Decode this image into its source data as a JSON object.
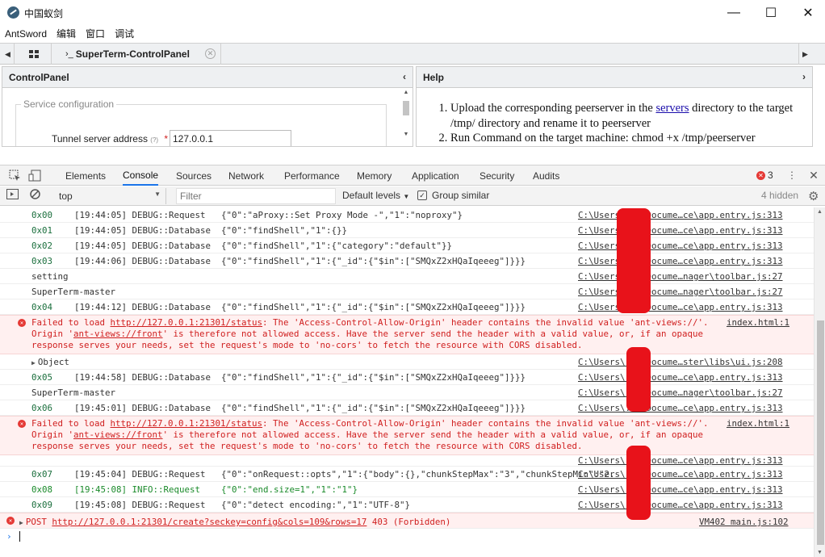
{
  "window": {
    "title": "中国蚁剑",
    "minimize": "—",
    "maximize": "☐",
    "close": "✕"
  },
  "menu": [
    "AntSword",
    "编辑",
    "窗口",
    "调试"
  ],
  "tabs": {
    "active_label": "SuperTerm-ControlPanel",
    "prompt_glyph": "›_"
  },
  "control_panel": {
    "title": "ControlPanel",
    "fieldset_legend": "Service configuration",
    "tunnel_label": "Tunnel server address",
    "tunnel_hint": "(?)",
    "required_mark": "*",
    "tunnel_value": "127.0.0.1"
  },
  "help": {
    "title": "Help",
    "step1_pre": "Upload the corresponding peerserver in the ",
    "step1_link": "servers",
    "step1_post": " directory to the target /tmp/ directory and rename it to peerserver",
    "step2": "Run Command on the target machine: chmod +x /tmp/peerserver"
  },
  "devtools": {
    "tabs": [
      "Elements",
      "Console",
      "Sources",
      "Network",
      "Performance",
      "Memory",
      "Application",
      "Security",
      "Audits"
    ],
    "active_tab": "Console",
    "error_count": "3",
    "context": "top",
    "filter_placeholder": "Filter",
    "levels": "Default levels",
    "group_similar": "Group similar",
    "hidden": "4 hidden"
  },
  "console": {
    "rows": [
      {
        "id": "0x00",
        "msg": "[19:44:05] DEBUG::Request   {\"0\":\"aProxy::Set Proxy Mode -\",\"1\":\"noproxy\"}",
        "src": "C:\\Users\\...\\Docume…ce\\app.entry.js:313"
      },
      {
        "id": "0x01",
        "msg": "[19:44:05] DEBUG::Database  {\"0\":\"findShell\",\"1\":{}}",
        "src": "C:\\Users\\...\\Docume…ce\\app.entry.js:313"
      },
      {
        "id": "0x02",
        "msg": "[19:44:05] DEBUG::Database  {\"0\":\"findShell\",\"1\":{\"category\":\"default\"}}",
        "src": "C:\\Users\\...\\Docume…ce\\app.entry.js:313"
      },
      {
        "id": "0x03",
        "msg": "[19:44:06] DEBUG::Database  {\"0\":\"findShell\",\"1\":{\"_id\":{\"$in\":[\"SMQxZ2xHQaIqeeeg\"]}}}",
        "src": "C:\\Users\\...\\Docume…ce\\app.entry.js:313"
      },
      {
        "plain": "setting",
        "src": "C:\\Users\\...\\Docume…nager\\toolbar.js:27"
      },
      {
        "plain": "SuperTerm-master",
        "src": "C:\\Users\\...\\Docume…nager\\toolbar.js:27"
      },
      {
        "id": "0x04",
        "msg": "[19:44:12] DEBUG::Database  {\"0\":\"findShell\",\"1\":{\"_id\":{\"$in\":[\"SMQxZ2xHQaIqeeeg\"]}}}",
        "src": "C:\\Users\\...\\Docume…ce\\app.entry.js:313"
      }
    ],
    "error1": {
      "pre": "Failed to load ",
      "url": "http://127.0.0.1:21301/status",
      "mid": ": The 'Access-Control-Allow-Origin' header contains the invalid value 'ant-views://'. Origin '",
      "origin": "ant-views://front",
      "post": "' is therefore not allowed access. Have the server send the header with a valid value, or, if an opaque response serves your needs, set the request's mode to 'no-cors' to fetch the resource with CORS disabled.",
      "src": "index.html:1"
    },
    "object_row": {
      "label": "Object",
      "src": "C:\\Users\\...\\Docume…ster\\libs\\ui.js:208"
    },
    "rows2": [
      {
        "id": "0x05",
        "msg": "[19:44:58] DEBUG::Database  {\"0\":\"findShell\",\"1\":{\"_id\":{\"$in\":[\"SMQxZ2xHQaIqeeeg\"]}}}",
        "src": "C:\\Users\\...\\Docume…ce\\app.entry.js:313"
      },
      {
        "plain": "SuperTerm-master",
        "src": "C:\\Users\\...\\Docume…nager\\toolbar.js:27"
      },
      {
        "id": "0x06",
        "msg": "[19:45:01] DEBUG::Database  {\"0\":\"findShell\",\"1\":{\"_id\":{\"$in\":[\"SMQxZ2xHQaIqeeeg\"]}}}",
        "src": "C:\\Users\\...\\Docume…ce\\app.entry.js:313"
      }
    ],
    "error2": {
      "pre": "Failed to load ",
      "url": "http://127.0.0.1:21301/status",
      "mid": ": The 'Access-Control-Allow-Origin' header contains the invalid value 'ant-views://'. Origin '",
      "origin": "ant-views://front",
      "post": "' is therefore not allowed access. Have the server send the header with a valid value, or, if an opaque response serves your needs, set the request's mode to 'no-cors' to fetch the resource with CORS disabled.",
      "src": "index.html:1"
    },
    "rows3": [
      {
        "id": "",
        "msg": "",
        "src": "C:\\Users\\...\\Docume…ce\\app.entry.js:313"
      },
      {
        "id": "0x07",
        "msg": "[19:45:04] DEBUG::Request   {\"0\":\"onRequest::opts\",\"1\":{\"body\":{},\"chunkStepMax\":\"3\",\"chunkStepMin\":\"2.",
        "src": "C:\\Users\\...\\Docume…ce\\app.entry.js:313"
      },
      {
        "id": "0x08",
        "msg": "[19:45:08] INFO::Request    {\"0\":\"end.size=1\",\"1\":\"1\"}",
        "src": "C:\\Users\\...\\Docume…ce\\app.entry.js:313",
        "info": true
      },
      {
        "id": "0x09",
        "msg": "[19:45:08] DEBUG::Request   {\"0\":\"detect encoding:\",\"1\":\"UTF-8\"}",
        "src": "C:\\Users\\...\\Docume…ce\\app.entry.js:313"
      }
    ],
    "post": {
      "method": "POST ",
      "url": "http://127.0.0.1:21301/create?seckey=config&cols=109&rows=17",
      "status": " 403 (Forbidden)",
      "src": "VM402 main.js:102"
    },
    "prompt": "›"
  },
  "colors": {
    "accent": "#1a73e8",
    "error": "#d02020",
    "info": "#1a8a2a",
    "redaction": "#e8121a"
  }
}
